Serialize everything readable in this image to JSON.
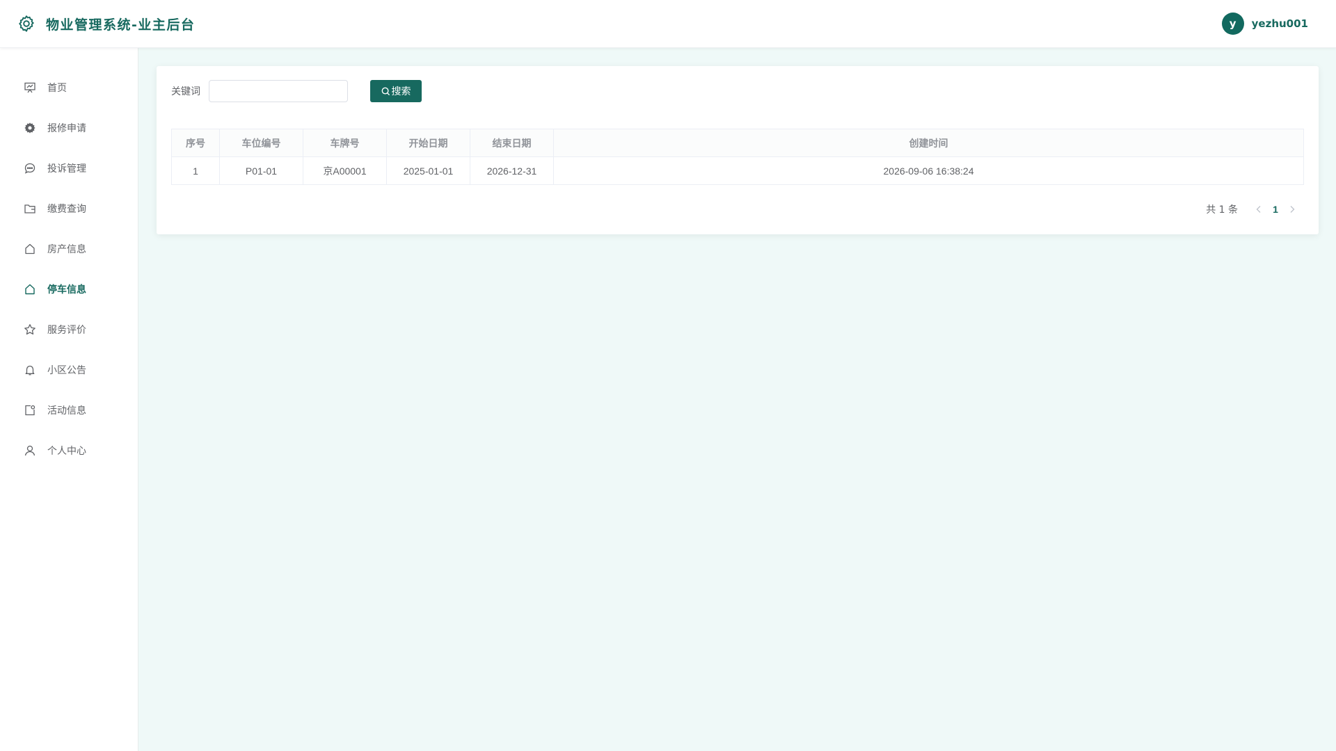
{
  "header": {
    "title": "物业管理系统-业主后台",
    "avatar_letter": "y",
    "username": "yezhu001",
    "brand_icon": "gear-icon"
  },
  "sidebar": {
    "items": [
      {
        "label": "首页",
        "icon": "presentation-icon",
        "active": false
      },
      {
        "label": "报修申请",
        "icon": "gear-icon",
        "active": false
      },
      {
        "label": "投诉管理",
        "icon": "chat-bubble-icon",
        "active": false
      },
      {
        "label": "缴费查询",
        "icon": "folder-icon",
        "active": false
      },
      {
        "label": "房产信息",
        "icon": "house-icon",
        "active": false
      },
      {
        "label": "停车信息",
        "icon": "house-icon",
        "active": true
      },
      {
        "label": "服务评价",
        "icon": "star-icon",
        "active": false
      },
      {
        "label": "小区公告",
        "icon": "bell-icon",
        "active": false
      },
      {
        "label": "活动信息",
        "icon": "calendar-tag-icon",
        "active": false
      },
      {
        "label": "个人中心",
        "icon": "user-icon",
        "active": false
      }
    ]
  },
  "search": {
    "label": "关键词",
    "value": "",
    "placeholder": "",
    "button_label": "搜索"
  },
  "table": {
    "columns": [
      "序号",
      "车位编号",
      "车牌号",
      "开始日期",
      "结束日期",
      "创建时间"
    ],
    "rows": [
      [
        "1",
        "P01-01",
        "京A00001",
        "2025-01-01",
        "2026-12-31",
        "2026-09-06 16:38:24"
      ]
    ]
  },
  "pagination": {
    "total_text": "共 1 条",
    "current_page": "1"
  },
  "colors": {
    "accent": "#17695f",
    "background": "#eff9f8"
  }
}
